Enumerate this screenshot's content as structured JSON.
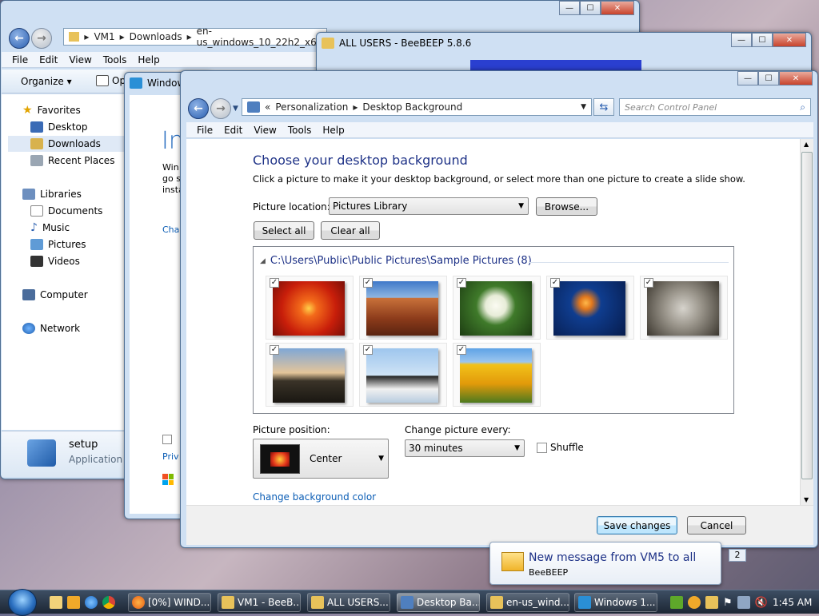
{
  "explorer": {
    "address": [
      "VM1",
      "Downloads",
      "en-us_windows_10_22h2_x6"
    ],
    "menu": [
      "File",
      "Edit",
      "View",
      "Tools",
      "Help"
    ],
    "organize_label": "Organize",
    "open_label": "Op",
    "sidebar": {
      "favorites_label": "Favorites",
      "favorites": [
        "Desktop",
        "Downloads",
        "Recent Places"
      ],
      "libraries_label": "Libraries",
      "libraries": [
        "Documents",
        "Music",
        "Pictures",
        "Videos"
      ],
      "computer_label": "Computer",
      "network_label": "Network"
    },
    "details": {
      "name": "setup",
      "type": "Application"
    }
  },
  "setup_window": {
    "title": "Window",
    "heading": "In",
    "lines": [
      "Win",
      "go s",
      "insta"
    ],
    "link1": "Cha",
    "link2": "Priv"
  },
  "beebeep": {
    "title": "ALL USERS - BeeBEEP 5.8.6"
  },
  "control_panel": {
    "address": [
      "Personalization",
      "Desktop Background"
    ],
    "address_prefix": "«",
    "search_placeholder": "Search Control Panel",
    "menu": [
      "File",
      "Edit",
      "View",
      "Tools",
      "Help"
    ],
    "heading": "Choose your desktop background",
    "subtitle": "Click a picture to make it your desktop background, or select more than one picture to create a slide show.",
    "picture_location_label": "Picture location:",
    "picture_location_value": "Pictures Library",
    "browse_label": "Browse...",
    "select_all_label": "Select all",
    "clear_all_label": "Clear all",
    "group_path": "C:\\Users\\Public\\Public Pictures\\Sample Pictures (8)",
    "thumbnails": [
      {
        "name": "chrysanthemum",
        "checked": "✓"
      },
      {
        "name": "desert",
        "checked": "✓"
      },
      {
        "name": "hydrangeas",
        "checked": "✓"
      },
      {
        "name": "jellyfish",
        "checked": "✓"
      },
      {
        "name": "koala",
        "checked": "✓"
      },
      {
        "name": "lighthouse",
        "checked": "✓"
      },
      {
        "name": "penguins",
        "checked": "✓"
      },
      {
        "name": "tulips",
        "checked": "✓"
      }
    ],
    "picture_position_label": "Picture position:",
    "picture_position_value": "Center",
    "change_every_label": "Change picture every:",
    "change_every_value": "30 minutes",
    "shuffle_label": "Shuffle",
    "change_color_link": "Change background color",
    "save_label": "Save changes",
    "cancel_label": "Cancel"
  },
  "notification": {
    "title": "New message from VM5 to all",
    "app": "BeeBEEP",
    "badge": "2"
  },
  "taskbar": {
    "buttons": [
      "[0%] WIND...",
      "VM1 - BeeB...",
      "ALL USERS...",
      "Desktop Ba...",
      "en-us_wind...",
      "Windows 1..."
    ],
    "clock": "1:45 AM"
  },
  "colors": {
    "accent": "#1e5aa8",
    "link": "#0b5db5",
    "heading": "#1e3287"
  }
}
